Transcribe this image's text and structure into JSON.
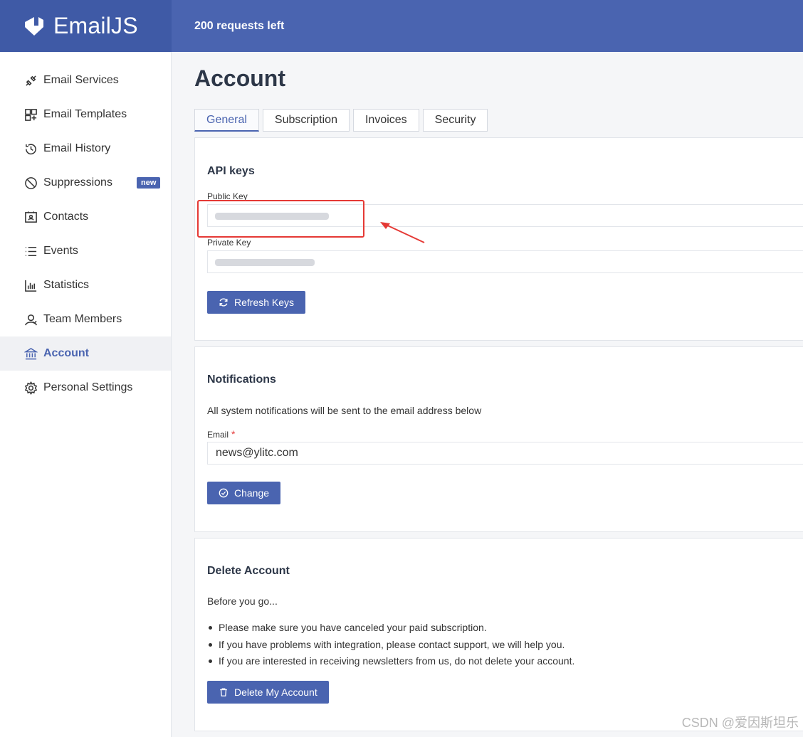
{
  "brand": {
    "name": "EmailJS"
  },
  "header": {
    "requests_left": "200 requests left"
  },
  "sidebar": {
    "items": [
      {
        "label": "Email Services",
        "icon": "plug-icon"
      },
      {
        "label": "Email Templates",
        "icon": "layout-icon"
      },
      {
        "label": "Email History",
        "icon": "history-icon"
      },
      {
        "label": "Suppressions",
        "icon": "ban-icon",
        "badge": "new"
      },
      {
        "label": "Contacts",
        "icon": "contact-card-icon"
      },
      {
        "label": "Events",
        "icon": "list-icon"
      },
      {
        "label": "Statistics",
        "icon": "bar-chart-icon"
      },
      {
        "label": "Team Members",
        "icon": "users-icon"
      },
      {
        "label": "Account",
        "icon": "bank-icon",
        "active": true
      },
      {
        "label": "Personal Settings",
        "icon": "gear-icon"
      }
    ]
  },
  "page": {
    "title": "Account"
  },
  "tabs": [
    {
      "label": "General",
      "active": true
    },
    {
      "label": "Subscription"
    },
    {
      "label": "Invoices"
    },
    {
      "label": "Security"
    }
  ],
  "api_keys": {
    "title": "API keys",
    "public_key_label": "Public Key",
    "private_key_label": "Private Key",
    "refresh_button": "Refresh Keys"
  },
  "notifications": {
    "title": "Notifications",
    "description": "All system notifications will be sent to the email address below",
    "email_label": "Email",
    "required_mark": "*",
    "email_value": "news@ylitc.com",
    "change_button": "Change"
  },
  "delete_account": {
    "title": "Delete Account",
    "intro": "Before you go...",
    "bullets": [
      "Please make sure you have canceled your paid subscription.",
      "If you have problems with integration, please contact support, we will help you.",
      "If you are interested in receiving newsletters from us, do not delete your account."
    ],
    "delete_button": "Delete My Account"
  },
  "watermark": "CSDN @爱因斯坦乐",
  "colors": {
    "brand": "#4a64b0",
    "brand_dark": "#3f5aa6",
    "annotation": "#e53935"
  }
}
